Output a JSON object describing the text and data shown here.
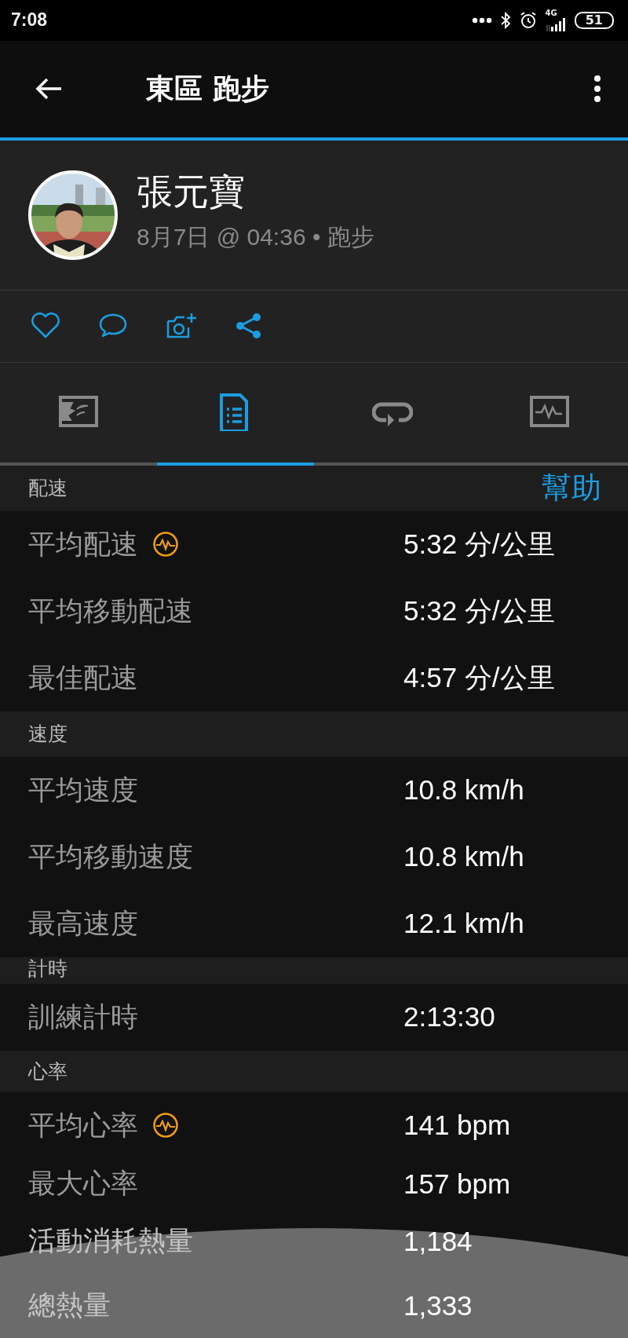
{
  "status_bar": {
    "time": "7:08",
    "network": "4G",
    "battery": "51"
  },
  "app_bar": {
    "title": "東區 跑步"
  },
  "activity": {
    "athlete": "張元寶",
    "meta": "8月7日 @ 04:36 • 跑步"
  },
  "tabs": [
    {
      "kind": "map",
      "selected": false
    },
    {
      "kind": "summary",
      "selected": true
    },
    {
      "kind": "laps",
      "selected": false
    },
    {
      "kind": "chart",
      "selected": false
    }
  ],
  "help_link": "幫助",
  "sections": [
    {
      "title": "配速",
      "rows": [
        {
          "label": "平均配速",
          "value": "5:32 分/公里",
          "pulse_icon": true
        },
        {
          "label": "平均移動配速",
          "value": "5:32 分/公里",
          "pulse_icon": false
        },
        {
          "label": "最佳配速",
          "value": "4:57 分/公里",
          "pulse_icon": false
        }
      ]
    },
    {
      "title": "速度",
      "rows": [
        {
          "label": "平均速度",
          "value": "10.8 km/h",
          "pulse_icon": false
        },
        {
          "label": "平均移動速度",
          "value": "10.8 km/h",
          "pulse_icon": false
        },
        {
          "label": "最高速度",
          "value": "12.1 km/h",
          "pulse_icon": false
        }
      ]
    },
    {
      "title": "計時",
      "rows": [
        {
          "label": "訓練計時",
          "value": "2:13:30",
          "pulse_icon": false
        }
      ]
    },
    {
      "title": "心率",
      "rows": [
        {
          "label": "平均心率",
          "value": "141 bpm",
          "pulse_icon": true
        },
        {
          "label": "最大心率",
          "value": "157 bpm",
          "pulse_icon": false
        },
        {
          "label": "活動消耗熱量",
          "value": "1,184",
          "pulse_icon": false
        },
        {
          "label": "總熱量",
          "value": "1,333",
          "pulse_icon": false
        }
      ]
    }
  ]
}
